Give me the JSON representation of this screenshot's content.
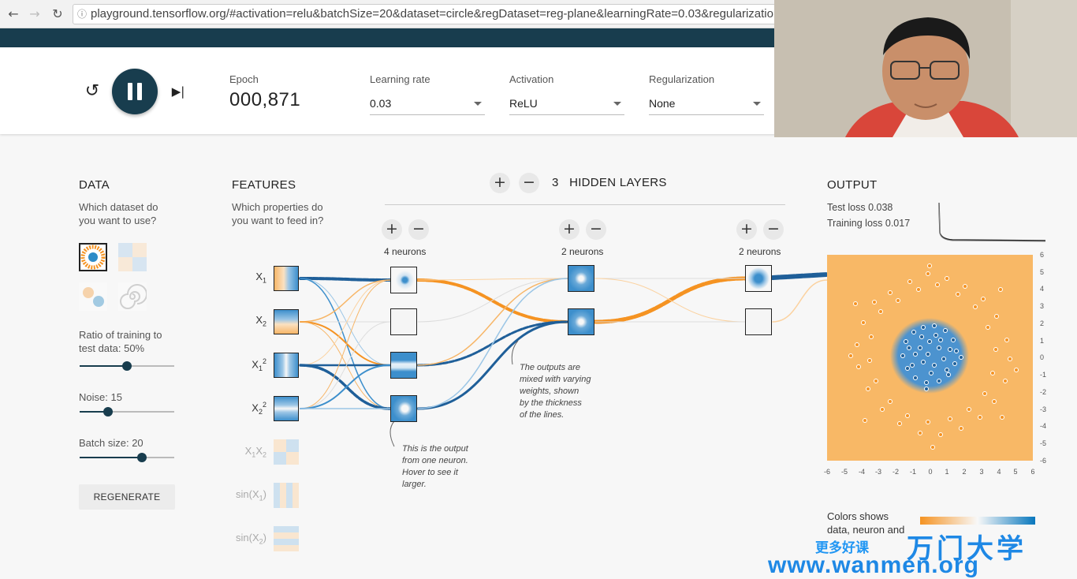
{
  "browser": {
    "url": "playground.tensorflow.org/#activation=relu&batchSize=20&dataset=circle&regDataset=reg-plane&learningRate=0.03&regularization"
  },
  "controls": {
    "epoch_label": "Epoch",
    "epoch_value": "000,871",
    "learning_rate_label": "Learning rate",
    "learning_rate_value": "0.03",
    "activation_label": "Activation",
    "activation_value": "ReLU",
    "regularization_label": "Regularization",
    "regularization_value": "None"
  },
  "data_panel": {
    "title": "DATA",
    "subtitle": "Which dataset do you want to use?",
    "ratio_label": "Ratio of training to test data:  50%",
    "ratio_value": 0.5,
    "noise_label": "Noise:  15",
    "noise_value": 0.3,
    "batch_label": "Batch size:  20",
    "batch_value": 0.66,
    "regenerate_label": "REGENERATE"
  },
  "features_panel": {
    "title": "FEATURES",
    "subtitle": "Which properties do you want to feed in?",
    "features": [
      {
        "base": "X",
        "sub": "1",
        "sup": "",
        "active": true
      },
      {
        "base": "X",
        "sub": "2",
        "sup": "",
        "active": true
      },
      {
        "base": "X",
        "sub": "1",
        "sup": "2",
        "active": true
      },
      {
        "base": "X",
        "sub": "2",
        "sup": "2",
        "active": true
      },
      {
        "base": "X",
        "sub": "1",
        "base2": "X",
        "sub2": "2",
        "active": false
      },
      {
        "base": "sin(X",
        "sub": "1",
        "suffix": ")",
        "active": false
      },
      {
        "base": "sin(X",
        "sub": "2",
        "suffix": ")",
        "active": false
      }
    ]
  },
  "network": {
    "hidden_layers_count": "3",
    "hidden_layers_label": "HIDDEN LAYERS",
    "layers": [
      {
        "neurons_label": "4 neurons"
      },
      {
        "neurons_label": "2 neurons"
      },
      {
        "neurons_label": "2 neurons"
      }
    ],
    "callout_neuron": [
      "This is the output",
      "from one neuron.",
      "Hover to see it",
      "larger."
    ],
    "callout_weights": [
      "The outputs are",
      "mixed with varying",
      "weights, shown",
      "by the thickness",
      "of the lines."
    ]
  },
  "output_panel": {
    "title": "OUTPUT",
    "test_loss": "Test loss 0.038",
    "training_loss": "Training loss 0.017",
    "y_ticks": [
      "6",
      "5",
      "4",
      "3",
      "2",
      "1",
      "0",
      "-1",
      "-2",
      "-3",
      "-4",
      "-5",
      "-6"
    ],
    "x_ticks": [
      "-6",
      "-5",
      "-4",
      "-3",
      "-2",
      "-1",
      "0",
      "1",
      "2",
      "3",
      "4",
      "5",
      "6"
    ],
    "legend_text": [
      "Colors shows",
      "data, neuron and"
    ]
  },
  "watermark": {
    "cn_small": "更多好课",
    "cn_big": "万门大学",
    "url": "www.wanmen.org"
  },
  "colors": {
    "orange": "#f59322",
    "blue": "#0877bd",
    "header": "#183d4e"
  }
}
